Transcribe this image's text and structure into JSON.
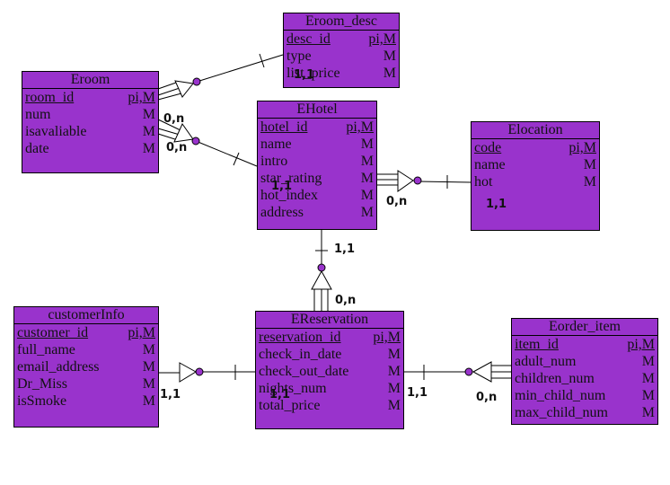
{
  "colors": {
    "entity_fill": "#9933cc",
    "line": "#000000"
  },
  "entities": [
    {
      "id": "eroom_desc",
      "title": "Eroom_desc",
      "rows": [
        [
          "desc_id",
          "pi,M",
          true
        ],
        [
          "type",
          "M",
          false
        ],
        [
          "list_price",
          "M",
          false
        ]
      ]
    },
    {
      "id": "eroom",
      "title": "Eroom",
      "rows": [
        [
          "room_id",
          "pi,M",
          true
        ],
        [
          "num",
          "M",
          false
        ],
        [
          "isavaliable",
          "M",
          false
        ],
        [
          "date",
          "M",
          false
        ]
      ]
    },
    {
      "id": "ehotel",
      "title": "EHotel",
      "rows": [
        [
          "hotel_id",
          "pi,M",
          true
        ],
        [
          "name",
          "M",
          false
        ],
        [
          "intro",
          "M",
          false
        ],
        [
          "star_rating",
          "M",
          false
        ],
        [
          "hot_index",
          "M",
          false
        ],
        [
          "address",
          "M",
          false
        ]
      ]
    },
    {
      "id": "elocation",
      "title": "Elocation",
      "rows": [
        [
          "code",
          "pi,M",
          true
        ],
        [
          "name",
          "M",
          false
        ],
        [
          "hot",
          "M",
          false
        ]
      ]
    },
    {
      "id": "customerinfo",
      "title": "customerInfo",
      "rows": [
        [
          "customer_id",
          "pi,M",
          true
        ],
        [
          "full_name",
          "M",
          false
        ],
        [
          "email_address",
          "M",
          false
        ],
        [
          "Dr_Miss",
          "M",
          false
        ],
        [
          "isSmoke",
          "M",
          false
        ]
      ]
    },
    {
      "id": "ereservation",
      "title": "EReservation",
      "rows": [
        [
          "reservation_id",
          "pi,M",
          true
        ],
        [
          "check_in_date",
          "M",
          false
        ],
        [
          "check_out_date",
          "M",
          false
        ],
        [
          "nights_num",
          "M",
          false
        ],
        [
          "total_price",
          "M",
          false
        ]
      ]
    },
    {
      "id": "eorder_item",
      "title": "Eorder_item",
      "rows": [
        [
          "item_id",
          "pi,M",
          true
        ],
        [
          "adult_num",
          "M",
          false
        ],
        [
          "children_num",
          "M",
          false
        ],
        [
          "min_child_num",
          "M",
          false
        ],
        [
          "max_child_num",
          "M",
          false
        ]
      ]
    }
  ],
  "cardinalities": [
    "1,1",
    "0,n",
    "0,n",
    "1,1",
    "0,n",
    "1,1",
    "1,1",
    "0,n",
    "1,1",
    "1,1",
    "1,1",
    "0,n"
  ]
}
